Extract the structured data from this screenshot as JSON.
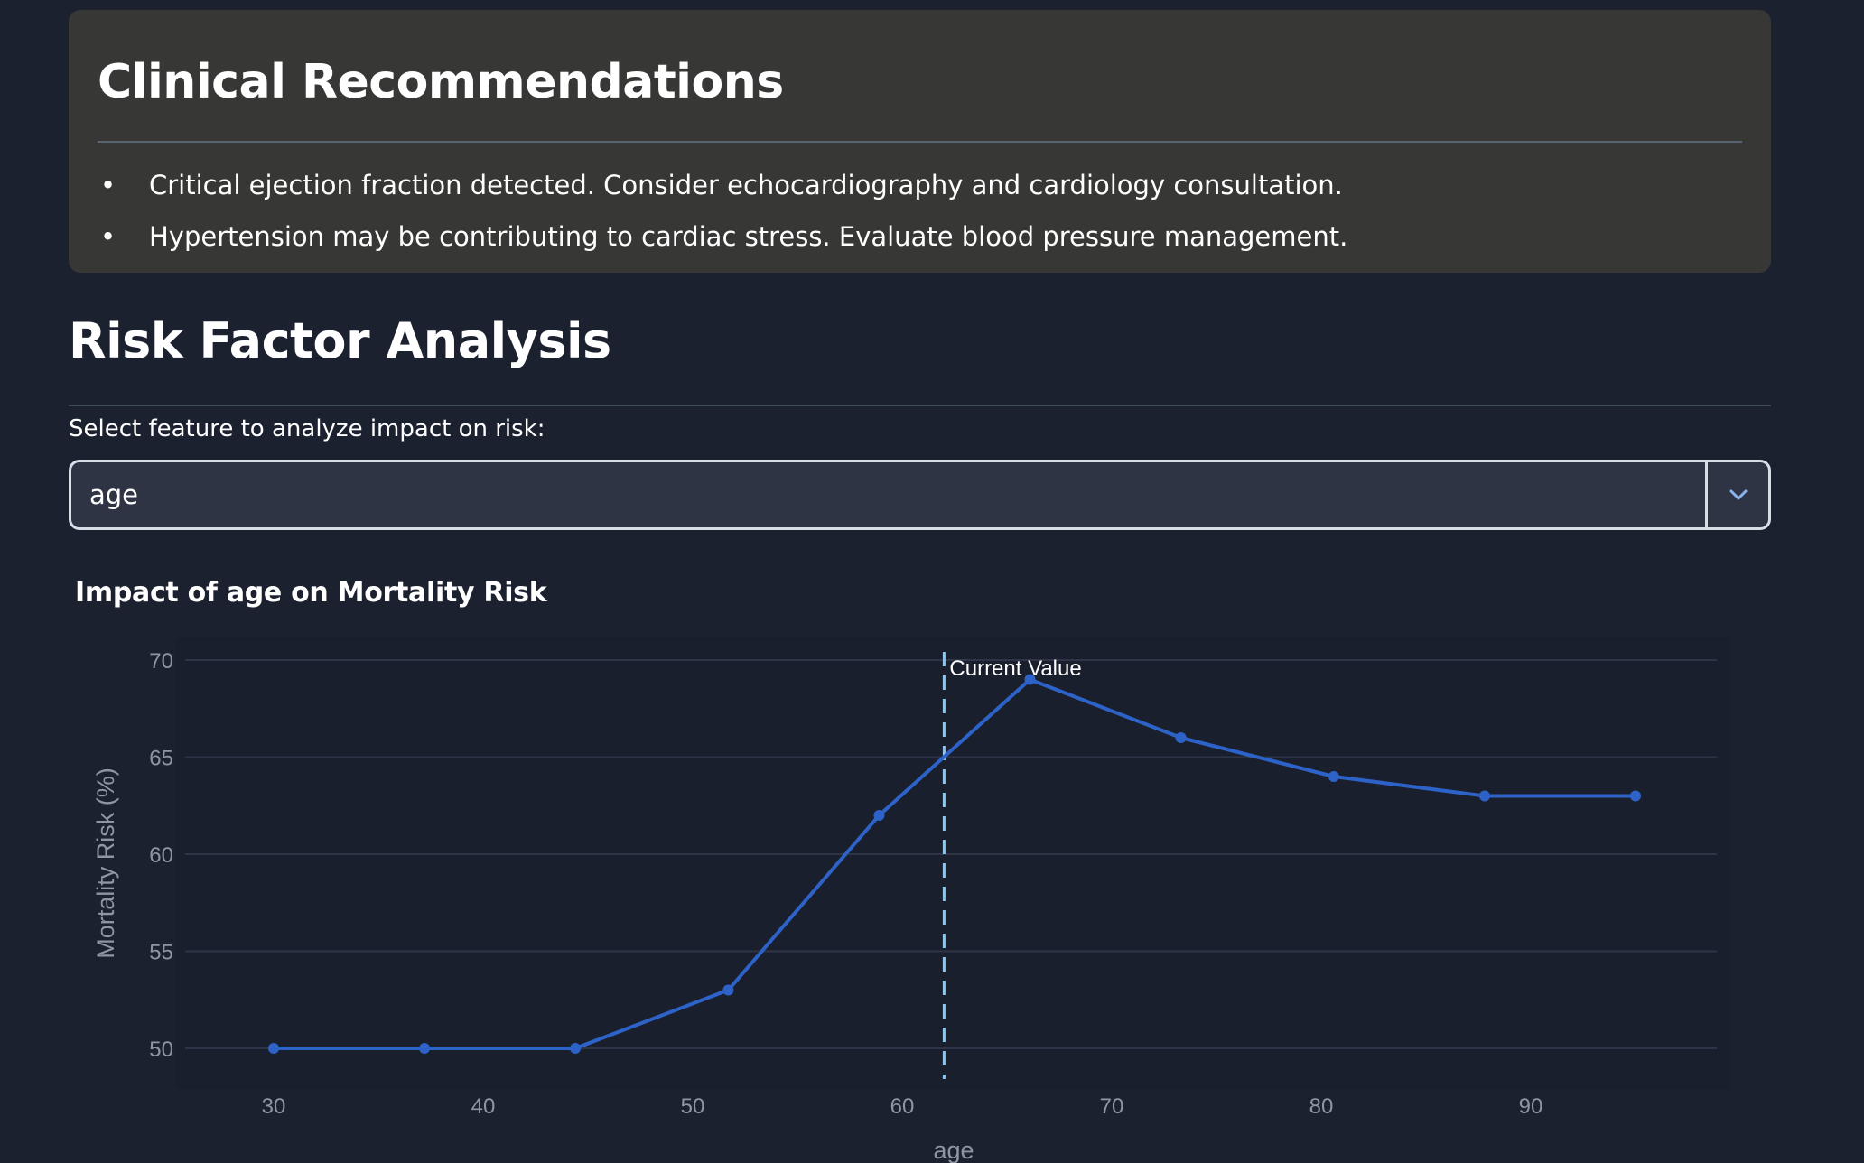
{
  "recommendations": {
    "title": "Clinical Recommendations",
    "items": [
      "Critical ejection fraction detected. Consider echocardiography and cardiology consultation.",
      "Hypertension may be contributing to cardiac stress. Evaluate blood pressure management."
    ]
  },
  "risk_analysis": {
    "title": "Risk Factor Analysis",
    "select_label": "Select feature to analyze impact on risk:",
    "selected_feature": "age",
    "chevron_icon": "chevron-down-icon"
  },
  "colors": {
    "line": "#2d63c8",
    "marker_line": "#90c4ec",
    "grid": "#2d3546",
    "plot_bg": "#1a1f2d"
  },
  "chart_data": {
    "type": "line",
    "title": "Impact of age on Mortality Risk",
    "xlabel": "age",
    "ylabel": "Mortality Risk (%)",
    "x": [
      30,
      37.2,
      44.4,
      51.7,
      58.9,
      66.1,
      73.3,
      80.6,
      87.8,
      95
    ],
    "y": [
      50,
      50,
      50,
      53,
      62,
      69,
      66,
      64,
      63,
      63
    ],
    "xlim": [
      25.3,
      99.8
    ],
    "ylim": [
      49.1,
      70
    ],
    "xticks": [
      30,
      40,
      50,
      60,
      70,
      80,
      90
    ],
    "yticks": [
      50,
      55,
      60,
      65,
      70
    ],
    "grid": true,
    "legend": "none",
    "current_value": 62,
    "current_value_label": "Current Value"
  }
}
